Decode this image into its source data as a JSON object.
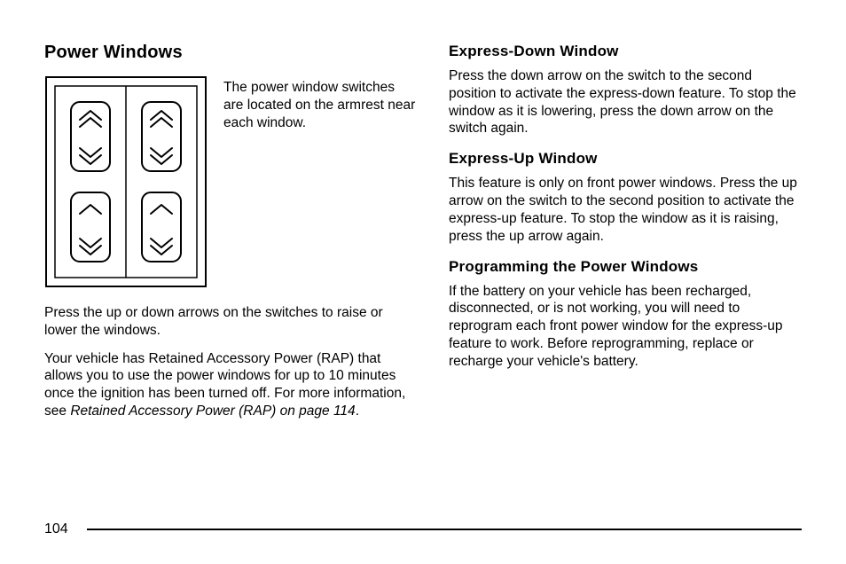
{
  "left": {
    "heading": "Power Windows",
    "intro": "The power window switches are located on the armrest near each window.",
    "p1": "Press the up or down arrows on the switches to raise or lower the windows.",
    "p2a": "Your vehicle has Retained Accessory Power (RAP) that allows you to use the power windows for up to 10 minutes once the ignition has been turned off. For more information, see ",
    "p2i": "Retained Accessory Power (RAP) on page 114",
    "p2b": "."
  },
  "right": {
    "h1": "Express-Down Window",
    "p1": "Press the down arrow on the switch to the second position to activate the express-down feature. To stop the window as it is lowering, press the down arrow on the switch again.",
    "h2": "Express-Up Window",
    "p2": "This feature is only on front power windows. Press the up arrow on the switch to the second position to activate the express-up feature. To stop the window as it is raising, press the up arrow again.",
    "h3": "Programming the Power Windows",
    "p3": "If the battery on your vehicle has been recharged, disconnected, or is not working, you will need to reprogram each front power window for the express-up feature to work. Before reprogramming, replace or recharge your vehicle's battery."
  },
  "pageNumber": "104"
}
